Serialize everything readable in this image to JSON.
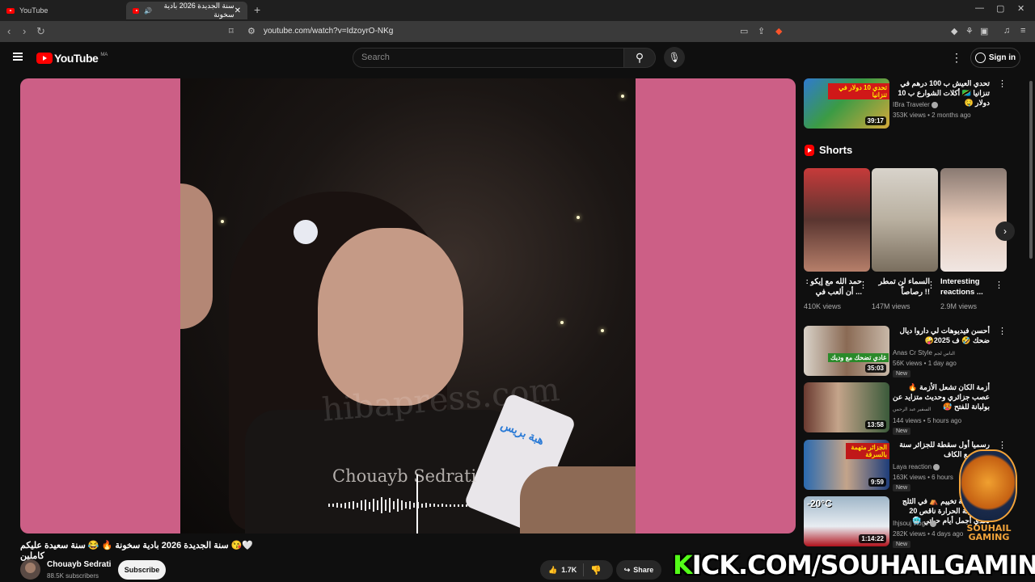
{
  "browser": {
    "tabs": [
      {
        "label": "YouTube"
      },
      {
        "label": "سنة الجديدة 2026 بادية سخونة"
      }
    ],
    "url": "youtube.com/watch?v=IdzoyrO-NKg"
  },
  "header": {
    "logo_text": "YouTube",
    "logo_country": "MA",
    "search_placeholder": "Search",
    "signin_label": "Sign in"
  },
  "video": {
    "title": "🤍😘 سنة الجديدة 2026 بادية سخونة 🔥 😂 سنة سعيدة عليكم كاملين",
    "watermark_name": "Chouayb Sedrati",
    "watermark_site": "hibapress.com",
    "mic_text": "هبة بريس",
    "channel_name": "Chouayb Sedrati",
    "channel_subs": "88.5K subscribers",
    "subscribe_label": "Subscribe",
    "likes": "1.7K",
    "share_label": "Share"
  },
  "overlay": {
    "kick_k": "K",
    "kick_rest": "ICK.COM/SOUHAILGAMING",
    "badge_line1": "SOUHAIL",
    "badge_line2": "GAMING"
  },
  "sidebar": {
    "top_item": {
      "title": "تحدي العيش ب 100 درهم في تنزانيا 🇹🇿 أكلات الشوارع ب 10 دولار 🤤",
      "channel": "IBra Traveler",
      "meta": "353K views • 2 months ago",
      "duration": "39:17",
      "thumb_text": "تحدي 10 دولار في تنزانيا"
    },
    "shorts_label": "Shorts",
    "shorts": [
      {
        "title": "حمد الله مع إيكو : ... أن ألعب في",
        "views": "410K views"
      },
      {
        "title": "السماء لن تمطر !! رصاصاً",
        "views": "147M views"
      },
      {
        "title": "Interesting reactions ...",
        "views": "2.9M views"
      }
    ],
    "items": [
      {
        "title": "أحسن فيديوهات لي داروا ديال ضحك 🤣 ف 2025🤪",
        "channel": "Anas Cr Style",
        "channel_extra": "الناس لجم",
        "meta": "56K views • 1 day ago",
        "badge": "New",
        "duration": "35:03",
        "thumb_text": "غادي تضحك مع وديك"
      },
      {
        "title": "أزمة الكان تشعل الأزمة 🔥 عصب جزائري وحديث متزايد عن بولبانة للفتح 🥵",
        "channel": "السفير عبد الرحمن",
        "meta": "144 views • 5 hours ago",
        "badge": "New",
        "duration": "13:58"
      },
      {
        "title": "رسميا أول سقطة للجزائر سنة 2026 مع الكاف",
        "channel": "Laya reaction",
        "meta": "163K views • 6 hours",
        "badge": "New",
        "duration": "9:59",
        "thumb_text": "الجزائر متهمة بالسرقة"
      },
      {
        "title": "جبال الحية تخييم ⛺ في الثلج يوم درجة الحرارة ناقص 20 تحدي أجمل أيام حياتي 🥶",
        "channel": "Ihjsouj vlogs",
        "meta": "282K views • 4 days ago",
        "badge": "New",
        "duration": "1:14:22",
        "thumb_text": "-20°C"
      }
    ]
  }
}
